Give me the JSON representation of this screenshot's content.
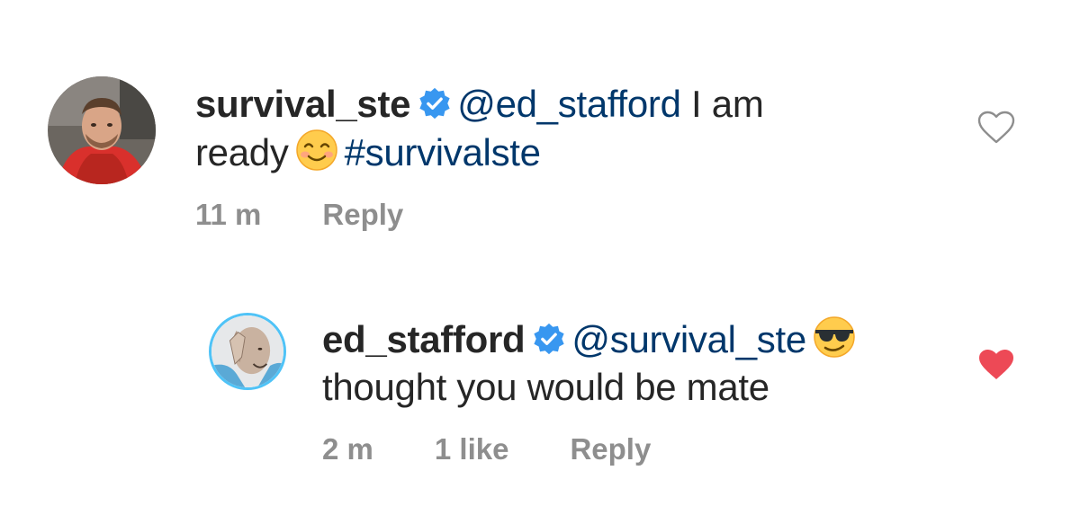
{
  "comments": [
    {
      "username": "survival_ste",
      "mention": "@ed_stafford",
      "text_after_mention": " I am",
      "text_line2": "ready",
      "emoji": "smiling-face-with-smiling-eyes",
      "hashtag": "#survivalste",
      "time": "11 m",
      "reply_label": "Reply",
      "liked": false
    },
    {
      "username": "ed_stafford",
      "mention": "@survival_ste",
      "emoji": "smiling-face-with-sunglasses",
      "text_line2": "thought you would be mate",
      "time": "2 m",
      "likes": "1 like",
      "reply_label": "Reply",
      "liked": true
    }
  ],
  "colors": {
    "mention": "#00376b",
    "verified": "#3897f0",
    "heart_liked": "#ed4956",
    "meta": "#8e8e8e",
    "text": "#262626"
  }
}
